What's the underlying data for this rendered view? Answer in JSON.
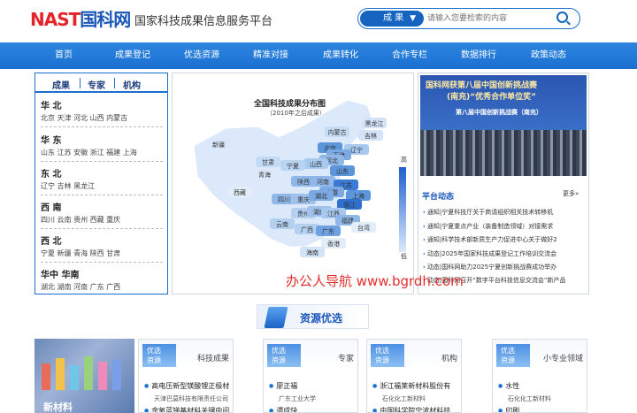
{
  "header": {
    "logo_word": "NAST",
    "logo_cn": "国科网",
    "site_title": "国家科技成果信息服务平台",
    "search": {
      "category": "成 果",
      "placeholder": "请输入您要检索的内容"
    }
  },
  "nav": [
    "首页",
    "成果登记",
    "优选资源",
    "精准对接",
    "成果转化",
    "合作专栏",
    "数据排行",
    "政策动态"
  ],
  "left_panel": {
    "tabs": [
      "成果",
      "专家",
      "机构"
    ],
    "regions": [
      {
        "name": "华 北",
        "cities": "北京 天津 河北 山西 内蒙古"
      },
      {
        "name": "华 东",
        "cities": "山东 江苏 安徽 浙江 福建 上海"
      },
      {
        "name": "东 北",
        "cities": "辽宁 吉林 黑龙江"
      },
      {
        "name": "西 南",
        "cities": "四川 云南 贵州 西藏 重庆"
      },
      {
        "name": "西 北",
        "cities": "宁夏 新疆 青海 陕西 甘肃"
      },
      {
        "name": "华中 华南",
        "cities": "湖北 湖南 河南 广东 广西"
      }
    ]
  },
  "map": {
    "title": "全国科技成果分布图",
    "subtitle": "（2010年之后成果）",
    "legend_high": "高",
    "legend_low": "低",
    "provinces": [
      {
        "name": "黑龙江",
        "shade": "#d3e4f8"
      },
      {
        "name": "吉林",
        "shade": "#d3e4f8"
      },
      {
        "name": "辽宁",
        "shade": "#a8c9ef"
      },
      {
        "name": "内蒙古",
        "shade": "#c6dcf5"
      },
      {
        "name": "北京",
        "shade": "#5b95dc"
      },
      {
        "name": "天津",
        "shade": "#7aa9e3"
      },
      {
        "name": "河北",
        "shade": "#8fb8e8"
      },
      {
        "name": "山西",
        "shade": "#a8c9ef"
      },
      {
        "name": "山东",
        "shade": "#5b95dc"
      },
      {
        "name": "新疆",
        "shade": "#d8e7f9"
      },
      {
        "name": "西藏",
        "shade": "#e2edfa"
      },
      {
        "name": "青海",
        "shade": "#dbe9fa"
      },
      {
        "name": "甘肃",
        "shade": "#c3dbf5"
      },
      {
        "name": "宁夏",
        "shade": "#b9d4f2"
      },
      {
        "name": "陕西",
        "shade": "#8fb8e8"
      },
      {
        "name": "河南",
        "shade": "#8fb8e8"
      },
      {
        "name": "江苏",
        "shade": "#3a7ad4"
      },
      {
        "name": "安徽",
        "shade": "#7aa9e3"
      },
      {
        "name": "上海",
        "shade": "#5b95dc"
      },
      {
        "name": "四川",
        "shade": "#8fb8e8"
      },
      {
        "name": "重庆",
        "shade": "#9fc2ec"
      },
      {
        "name": "湖北",
        "shade": "#7aa9e3"
      },
      {
        "name": "浙江",
        "shade": "#2f6fcf"
      },
      {
        "name": "贵州",
        "shade": "#b3d0f1"
      },
      {
        "name": "湖南",
        "shade": "#9fc2ec"
      },
      {
        "name": "江西",
        "shade": "#a8c9ef"
      },
      {
        "name": "福建",
        "shade": "#8fb8e8"
      },
      {
        "name": "云南",
        "shade": "#b3d0f1"
      },
      {
        "name": "广西",
        "shade": "#b3d0f1"
      },
      {
        "name": "广东",
        "shade": "#6ea1e0"
      },
      {
        "name": "台湾",
        "shade": "#e2edfa"
      },
      {
        "name": "香港",
        "shade": "#e2edfa"
      },
      {
        "name": "海南",
        "shade": "#d3e4f8"
      }
    ]
  },
  "banner": {
    "line1": "国科网获第八届中国创新挑战赛",
    "line2": "(南充)“优秀合作单位奖”",
    "line3": "第八届中国创新挑战赛（南充）"
  },
  "platform": {
    "title": "平台动态",
    "more": "更多»",
    "news": [
      "通知|宁夏科技厅关于商请组织相关技术转移机",
      "通知|宁夏重点产业（装备制造领域）对接需求",
      "通知|科学技术部新质生产力促进中心关于做好2",
      "动态|2025年国家科技成果登记工作培训交流会",
      "动态|国科网助力2025宁夏创新挑战赛成功举办",
      "动态|国科网召开“数字平台科技信息交流会”新产品"
    ]
  },
  "watermark": "办公人导航 www.bgrdh.com",
  "section": {
    "title": "资源优选"
  },
  "cards": {
    "pic_label": "新材料",
    "items": [
      {
        "tag": [
          "优选",
          "资源"
        ],
        "title": "科技成果",
        "l1": "高电压新型镁酸锂正极材",
        "s1": "天津巴莫科技有限责任公司",
        "l2": "金氧蓝锑基材料关键中间"
      },
      {
        "tag": [
          "优选",
          "资源"
        ],
        "title": "专家",
        "l1": "廖正福",
        "s1": "广东工业大学",
        "l2": "谭成快"
      },
      {
        "tag": [
          "优选",
          "资源"
        ],
        "title": "机构",
        "l1": "浙江福莱新材料股份有",
        "s1": "石化化工新材料",
        "l2": "中国科学院宁波材料技"
      },
      {
        "tag": [
          "优选",
          "资源"
        ],
        "title": "小专业领域",
        "l1": "水性",
        "s1": "石化化工新材料",
        "l2": "印刷"
      }
    ]
  }
}
